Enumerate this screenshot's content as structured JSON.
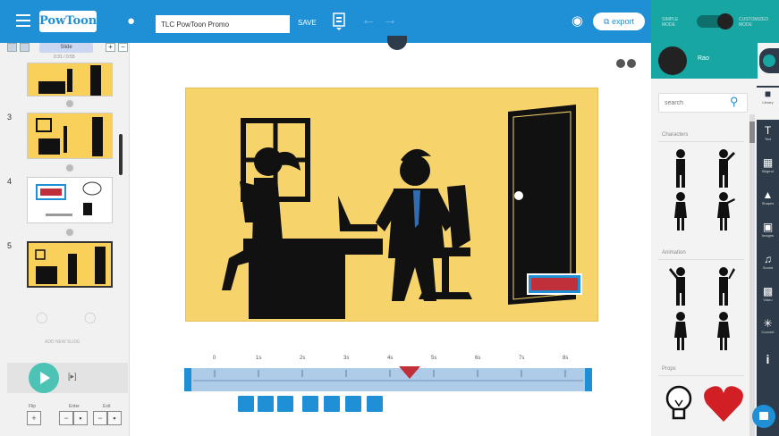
{
  "header": {
    "logo": "PowToon",
    "title_value": "TLC PowToon Promo",
    "save_label": "SAVE",
    "export_label": "export",
    "simple_mode": "SIMPLE MODE",
    "customized_mode": "CUSTOMIZED MODE"
  },
  "slides_panel": {
    "tab_label": "Slide",
    "timecode": "0:31 / 0:55",
    "slide_numbers": [
      "3",
      "4",
      "5"
    ],
    "add_slide_label": "ADD NEW SLIDE",
    "controls": {
      "play_label": "Play",
      "skip_label": "[▸]",
      "flip_label": "Flip",
      "enter_label": "Enter",
      "exit_label": "Exit"
    }
  },
  "timeline": {
    "ticks": [
      "0",
      "1s",
      "2s",
      "3s",
      "4s",
      "5s",
      "6s",
      "7s",
      "8s"
    ],
    "cursor_seconds": 4.5
  },
  "right_panel": {
    "character_name": "Rao",
    "search_placeholder": "search",
    "sections": [
      "Characters",
      "Animation",
      "Props"
    ],
    "sidebar": [
      "Library",
      "Text",
      "Bkgrnd",
      "Shapes",
      "Images",
      "Sound",
      "Video",
      "Convert"
    ]
  },
  "colors": {
    "brand_blue": "#1f8fd6",
    "teal": "#17a6a2",
    "dark": "#2d3b4a",
    "stage_yellow": "#f7d36b",
    "play_green": "#4cc3b5",
    "cursor_red": "#c0303b"
  },
  "icons": [
    "menu-icon",
    "bell-icon",
    "document-icon",
    "undo-icon",
    "redo-icon",
    "eye-icon",
    "export-icon",
    "search-icon",
    "info-icon",
    "chat-icon"
  ]
}
